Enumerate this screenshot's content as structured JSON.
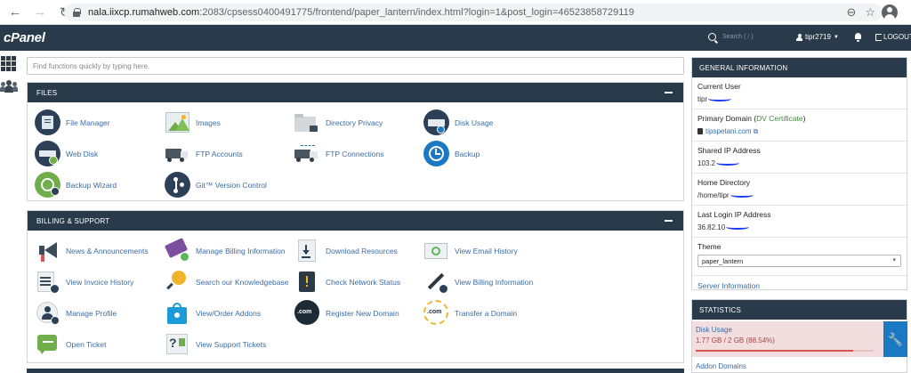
{
  "browser": {
    "url_host": "nala.iixcp.rumahweb.com",
    "url_path": ":2083/cpsess0400491775/frontend/paper_lantern/index.html?login=1&post_login=46523858729119"
  },
  "topbar": {
    "logo": "cPanel",
    "search_placeholder": "Search ( / )",
    "username": "tipr2719",
    "logout": "LOGOUT"
  },
  "find_placeholder": "Find functions quickly by typing here.",
  "files": {
    "title": "FILES",
    "items": [
      "File Manager",
      "Images",
      "Directory Privacy",
      "Disk Usage",
      "Web Disk",
      "FTP Accounts",
      "FTP Connections",
      "Backup",
      "Backup Wizard",
      "Git™ Version Control"
    ]
  },
  "billing": {
    "title": "BILLING & SUPPORT",
    "items": [
      "News & Announcements",
      "Manage Billing Information",
      "Download Resources",
      "View Email History",
      "View Invoice History",
      "Search our Knowledgebase",
      "Check Network Status",
      "View Billing Information",
      "Manage Profile",
      "View/Order Addons",
      "Register New Domain",
      "Transfer a Domain",
      "Open Ticket",
      "View Support Tickets"
    ]
  },
  "general_info": {
    "title": "GENERAL INFORMATION",
    "current_user_label": "Current User",
    "current_user_value": "tipr",
    "primary_domain_label": "Primary Domain (",
    "dv_label": "DV Certificate",
    "primary_domain_close": ")",
    "primary_domain_value": "tipspetani.com",
    "shared_ip_label": "Shared IP Address",
    "shared_ip_value": "103.2",
    "home_dir_label": "Home Directory",
    "home_dir_value": "/home/tipr",
    "last_login_label": "Last Login IP Address",
    "last_login_value": "36.82.10",
    "theme_label": "Theme",
    "theme_value": "paper_lantern",
    "server_info": "Server Information"
  },
  "statistics": {
    "title": "STATISTICS",
    "disk_label": "Disk Usage",
    "disk_value": "1.77 GB / 2 GB   (88.54%)",
    "disk_fraction": 0.8854,
    "addon": "Addon Domains"
  },
  "colors": {
    "header": "#293a4a",
    "link": "#3a6da6",
    "danger_bg": "#f2dede"
  }
}
